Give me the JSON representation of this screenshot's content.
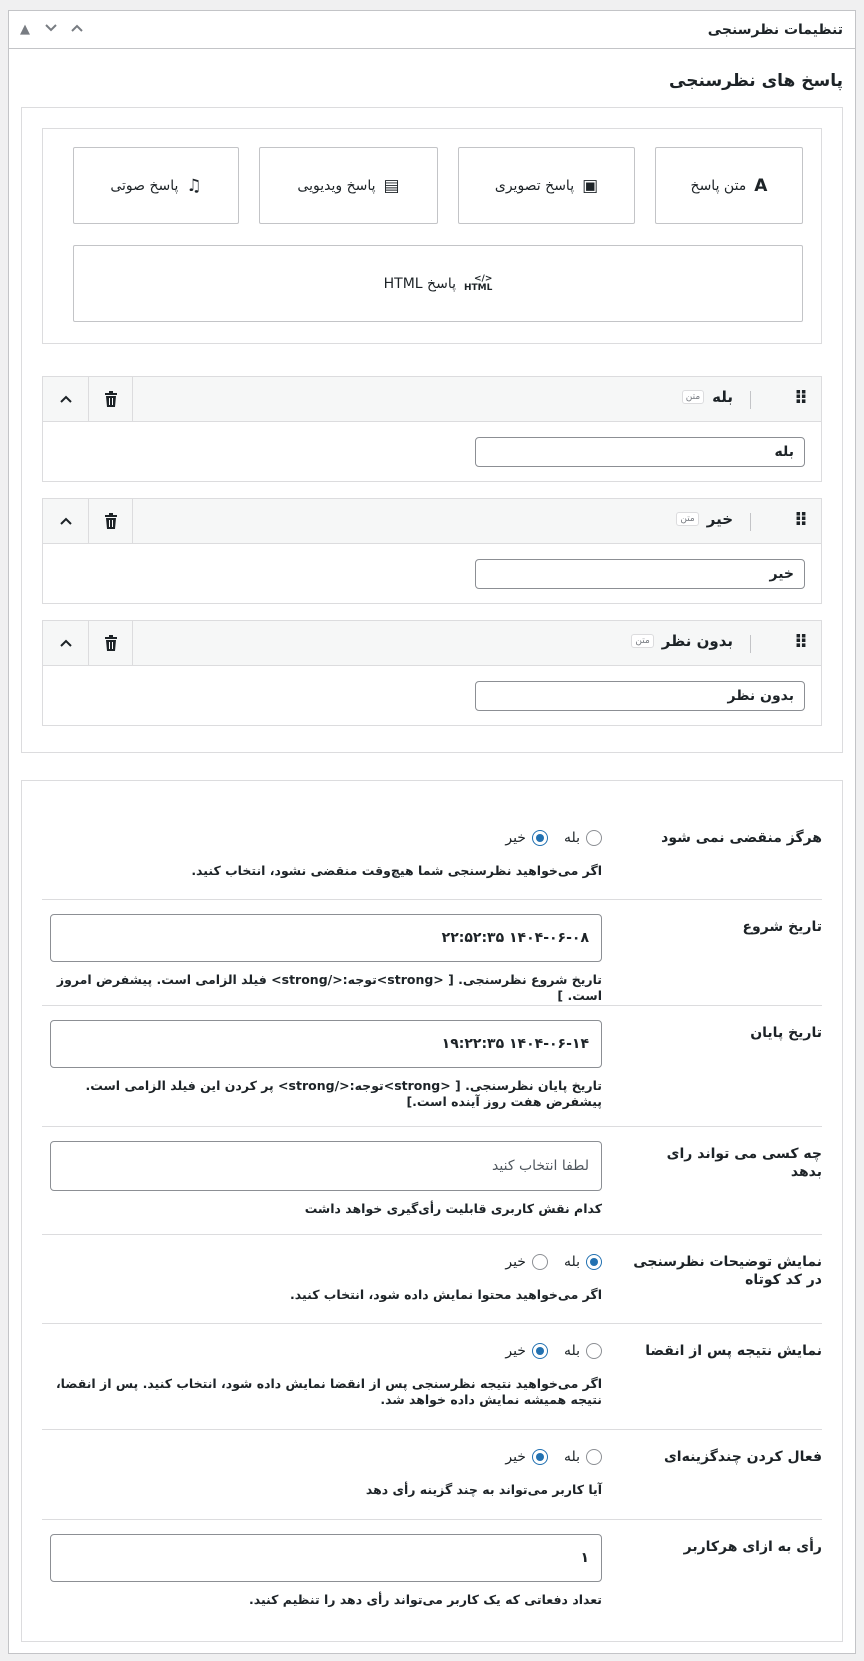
{
  "metabox": {
    "title": "تنظیمات نظرسنجی",
    "controls": [
      "move-up",
      "move-down",
      "toggle"
    ]
  },
  "answers_section": {
    "title": "پاسخ های نظرسنجی",
    "answer_types": [
      {
        "label": "متن پاسخ",
        "icon": "text-a-icon",
        "glyph": "A"
      },
      {
        "label": "پاسخ تصویری",
        "icon": "image-icon",
        "glyph": "▣"
      },
      {
        "label": "پاسخ ویدیویی",
        "icon": "video-icon",
        "glyph": "▤"
      },
      {
        "label": "پاسخ صوتی",
        "icon": "music-note-icon",
        "glyph": "♫"
      },
      {
        "label": "پاسخ HTML",
        "icon": "html-icon",
        "glyph": "</>\nHTML"
      }
    ],
    "answers": [
      {
        "title": "بله",
        "badge": "متن",
        "value": "بله"
      },
      {
        "title": "خیر",
        "badge": "متن",
        "value": "خیر"
      },
      {
        "title": "بدون نظر",
        "badge": "متن",
        "value": "بدون نظر"
      }
    ]
  },
  "settings": {
    "never_expires": {
      "label": "هرگز منقضی نمی شود",
      "yes": "بله",
      "no": "خیر",
      "selected": "no",
      "desc": "اگر می‌خواهید نظرسنجی شما هیچ‌وقت منقضی نشود، انتخاب کنید."
    },
    "start_date": {
      "label": "تاریخ شروع",
      "value": "۱۴۰۴-۰۶-۰۸ ۲۲:۵۲:۳۵",
      "desc": "تاریخ شروع نظرسنجی. [ <strong>توجه:</strong> فیلد الزامی است. پیشفرض امروز است. ]"
    },
    "end_date": {
      "label": "تاریخ پایان",
      "value": "۱۴۰۴-۰۶-۱۴ ۱۹:۲۲:۳۵",
      "desc": "تاریخ پایان نظرسنجی. [ <strong>توجه:</strong> پر کردن این فیلد الزامی است. پیشفرض هفت روز آینده است.]"
    },
    "who_can_vote": {
      "label": "چه کسی می تواند رای بدهد",
      "placeholder": "لطفا انتخاب کنید",
      "desc": "کدام نقش کاربری قابلیت رأی‌گیری خواهد داشت"
    },
    "show_excerpt": {
      "label": "نمایش توضیحات نظرسنجی در کد کوتاه",
      "yes": "بله",
      "no": "خیر",
      "selected": "yes",
      "desc": "اگر می‌خواهید محتوا نمایش داده شود، انتخاب کنید."
    },
    "show_result_after_expire": {
      "label": "نمایش نتیجه پس از انقضا",
      "yes": "بله",
      "no": "خیر",
      "selected": "no",
      "desc": "اگر می‌خواهید نتیجه نظرسنجی پس از انقضا نمایش داده شود، انتخاب کنید. پس از انقضا، نتیجه همیشه نمایش داده خواهد شد."
    },
    "multiple_choice": {
      "label": "فعال کردن چندگزینه‌ای",
      "yes": "بله",
      "no": "خیر",
      "selected": "no",
      "desc": "آیا کاربر می‌تواند به چند گزینه رأی دهد"
    },
    "votes_per_user": {
      "label": "رأی به ازای هرکاربر",
      "value": "۱",
      "desc": "تعداد دفعاتی که یک کاربر می‌تواند رأی دهد را تنظیم کنید."
    }
  },
  "colors": {
    "accent": "#2271b1",
    "border": "#c3c4c7",
    "header_bg": "#f6f7f7"
  }
}
